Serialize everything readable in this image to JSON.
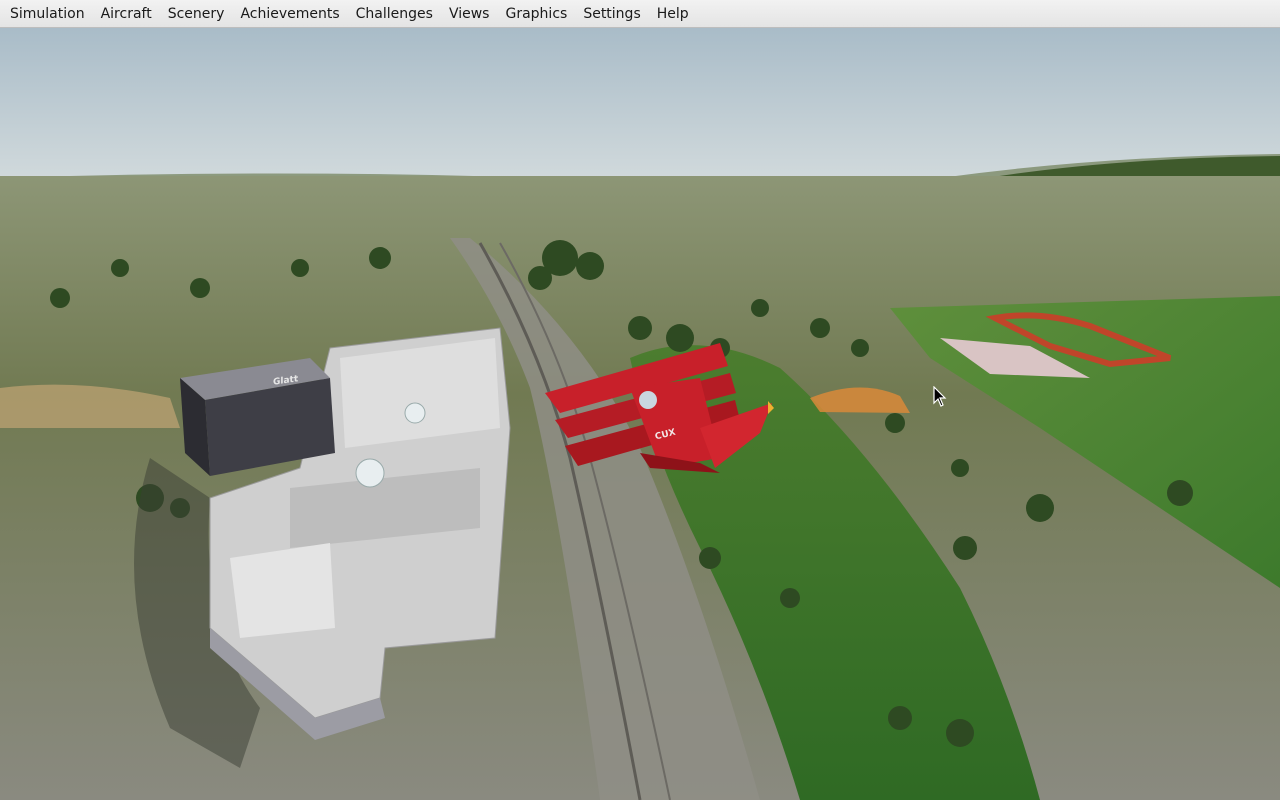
{
  "menu": {
    "items": [
      {
        "id": "simulation",
        "label": "Simulation"
      },
      {
        "id": "aircraft",
        "label": "Aircraft"
      },
      {
        "id": "scenery",
        "label": "Scenery"
      },
      {
        "id": "achievements",
        "label": "Achievements"
      },
      {
        "id": "challenges",
        "label": "Challenges"
      },
      {
        "id": "views",
        "label": "Views"
      },
      {
        "id": "graphics",
        "label": "Graphics"
      },
      {
        "id": "settings",
        "label": "Settings"
      },
      {
        "id": "help",
        "label": "Help"
      }
    ]
  },
  "scene": {
    "building_sign": "Glatt",
    "aircraft_livery_text": "CUX",
    "colors": {
      "sky_top": "#aebfca",
      "sky_horizon": "#cfd8dc",
      "terrain_dark": "#5f6b45",
      "terrain_light": "#9aa07a",
      "aircraft_red": "#c8202a",
      "building_dark": "#3c3c44",
      "building_roof": "#d6d6d6"
    }
  }
}
